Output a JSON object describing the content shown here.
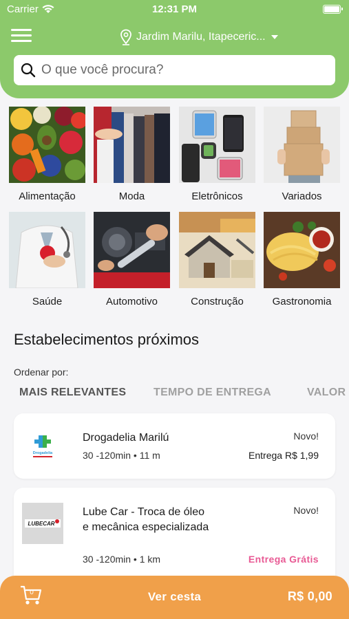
{
  "status": {
    "carrier": "Carrier",
    "time": "12:31 PM"
  },
  "header": {
    "location": "Jardim Marilu, Itapeceric..."
  },
  "search": {
    "placeholder": "O que você procura?"
  },
  "categories": [
    {
      "label": "Alimentação"
    },
    {
      "label": "Moda"
    },
    {
      "label": "Eletrônicos"
    },
    {
      "label": "Variados"
    },
    {
      "label": "Saúde"
    },
    {
      "label": "Automotivo"
    },
    {
      "label": "Construção"
    },
    {
      "label": "Gastronomia"
    }
  ],
  "section": {
    "title": "Estabelecimentos próximos",
    "order_label": "Ordenar por:"
  },
  "sort_tabs": [
    {
      "label": "MAIS RELEVANTES"
    },
    {
      "label": "TEMPO DE ENTREGA"
    },
    {
      "label": "VALOR"
    }
  ],
  "stores": [
    {
      "name": "Drogadelia Marilú",
      "meta": "30 -120min • 11 m",
      "badge": "Novo!",
      "fee": "Entrega R$ 1,99",
      "logo_text": "Drogadelia"
    },
    {
      "name": "Lube Car - Troca de óleo e mecânica especializada",
      "meta": "30 -120min • 1 km",
      "badge": "Novo!",
      "fee": "Entrega Grátis",
      "logo_text": "LUBECAR"
    }
  ],
  "cart": {
    "count": "0",
    "label": "Ver cesta",
    "total": "R$ 0,00"
  },
  "colors": {
    "header": "#8cc96b",
    "bottom_bar": "#f0a04a",
    "free_delivery": "#e85a94"
  }
}
